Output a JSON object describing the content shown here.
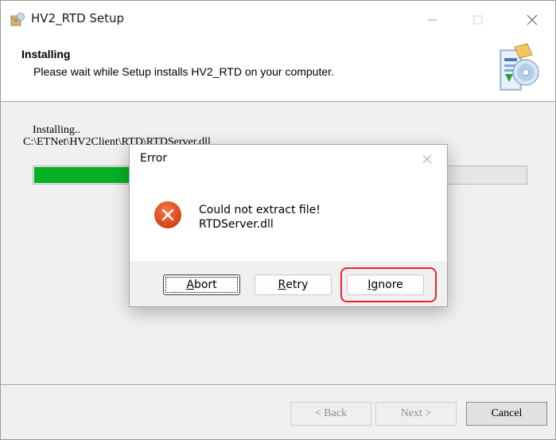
{
  "window": {
    "title": "HV2_RTD Setup"
  },
  "header": {
    "title": "Installing",
    "subtitle": "Please wait while Setup installs HV2_RTD on your computer."
  },
  "body": {
    "status_label": "Installing..",
    "status_path": "C:\\ETNet\\HV2Client\\RTD\\RTDServer.dll",
    "progress_fraction": 0.58
  },
  "footer": {
    "back_label": "< Back",
    "next_label": "Next >",
    "cancel_label": "Cancel"
  },
  "dialog": {
    "title": "Error",
    "message_line1": "Could not extract file!",
    "message_line2": "RTDServer.dll",
    "buttons": {
      "abort": {
        "accel": "A",
        "rest": "bort"
      },
      "retry": {
        "accel": "R",
        "rest": "etry"
      },
      "ignore": {
        "accel": "I",
        "rest": "gnore"
      }
    }
  },
  "colors": {
    "progress_fill": "#06b025",
    "error_icon": "#e0481e",
    "highlight": "#e8232d"
  },
  "icons": {
    "app": "setup-box-icon",
    "header": "installer-cd-icon",
    "error": "error-x-icon"
  }
}
